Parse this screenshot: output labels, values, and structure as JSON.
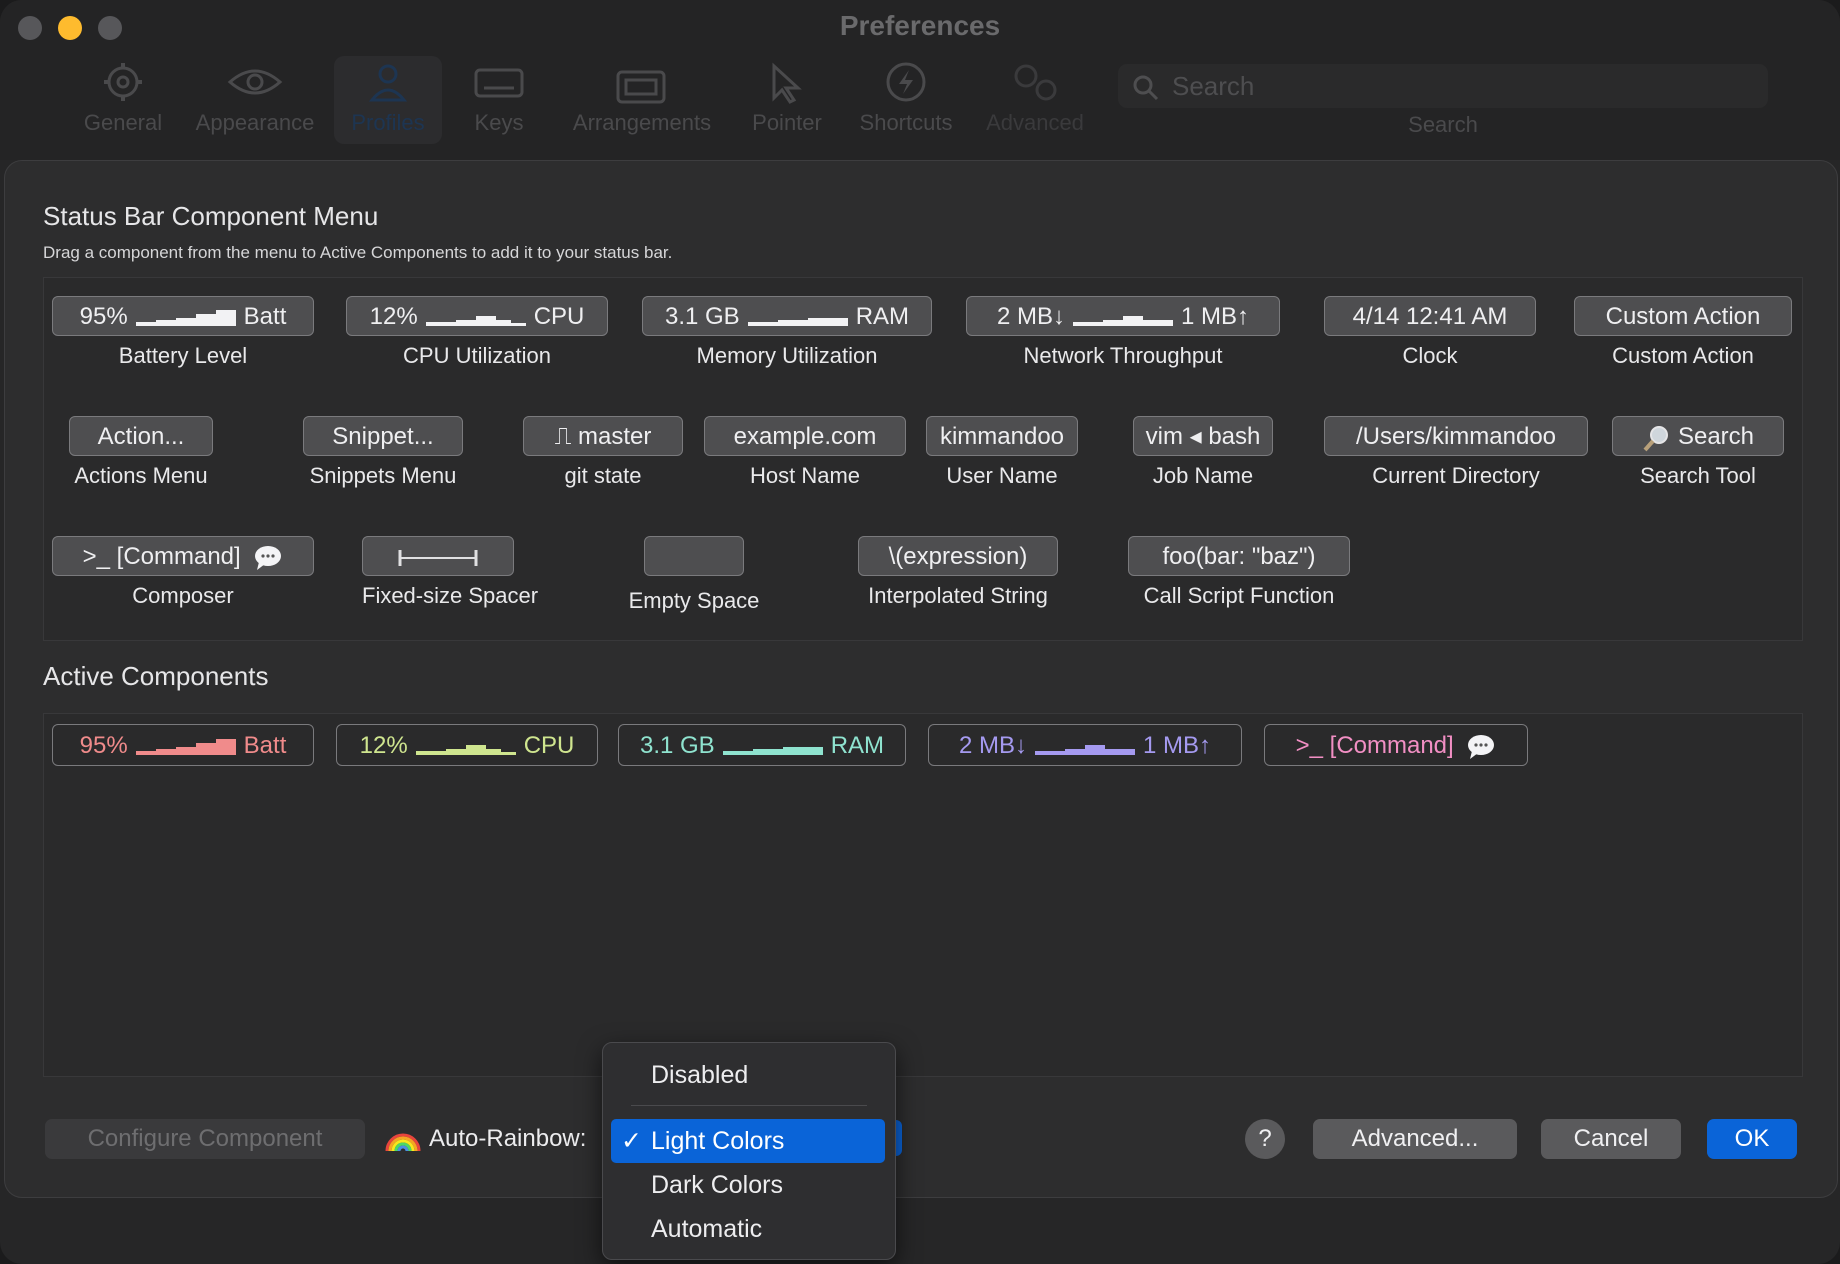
{
  "window": {
    "title": "Preferences"
  },
  "toolbar": {
    "items": [
      {
        "label": "General",
        "icon": "gear-icon"
      },
      {
        "label": "Appearance",
        "icon": "eye-icon"
      },
      {
        "label": "Profiles",
        "icon": "person-icon",
        "selected": true
      },
      {
        "label": "Keys",
        "icon": "keyboard-icon"
      },
      {
        "label": "Arrangements",
        "icon": "windows-icon"
      },
      {
        "label": "Pointer",
        "icon": "cursor-icon"
      },
      {
        "label": "Shortcuts",
        "icon": "bolt-icon"
      },
      {
        "label": "Advanced",
        "icon": "gears-icon"
      }
    ],
    "search": {
      "placeholder": "Search",
      "label": "Search"
    }
  },
  "menu": {
    "title": "Status Bar Component Menu",
    "subtitle": "Drag a component from the menu to Active Components to add it to your status bar.",
    "components": [
      {
        "left": "95%",
        "right": "Batt",
        "label": "Battery Level"
      },
      {
        "left": "12%",
        "right": "CPU",
        "label": "CPU Utilization"
      },
      {
        "left": "3.1 GB",
        "right": "RAM",
        "label": "Memory Utilization"
      },
      {
        "left": "2 MB↓",
        "right": "1 MB↑",
        "label": "Network Throughput"
      },
      {
        "text": "4/14 12:41 AM",
        "label": "Clock"
      },
      {
        "text": "Custom Action",
        "label": "Custom Action"
      },
      {
        "text": "Action...",
        "label": "Actions Menu"
      },
      {
        "text": "Snippet...",
        "label": "Snippets Menu"
      },
      {
        "text": "⎍ master",
        "label": "git state"
      },
      {
        "text": "example.com",
        "label": "Host Name"
      },
      {
        "text": "kimmandoo",
        "label": "User Name"
      },
      {
        "text": "vim ◂ bash",
        "label": "Job Name"
      },
      {
        "text": "/Users/kimmandoo",
        "label": "Current Directory"
      },
      {
        "text": "Search",
        "label": "Search Tool"
      },
      {
        "text": ">_ [Command]",
        "label": "Composer"
      },
      {
        "text": "",
        "label": "Fixed-size Spacer"
      },
      {
        "text": "",
        "label": "Empty Space"
      },
      {
        "text": "\\(expression)",
        "label": "Interpolated String"
      },
      {
        "text": "foo(bar: \"baz\")",
        "label": "Call Script Function"
      }
    ]
  },
  "active": {
    "title": "Active Components",
    "items": [
      {
        "left": "95%",
        "right": "Batt",
        "color": "#f08b8b"
      },
      {
        "left": "12%",
        "right": "CPU",
        "color": "#cfe58f"
      },
      {
        "left": "3.1 GB",
        "right": "RAM",
        "color": "#8fe3cf"
      },
      {
        "left": "2 MB↓",
        "right": "1 MB↑",
        "color": "#a59af0"
      },
      {
        "text": ">_ [Command]",
        "color": "#f28fc4"
      }
    ]
  },
  "bottom": {
    "configure": "Configure Component",
    "rainbow_label": "Auto-Rainbow:",
    "help": "?",
    "advanced": "Advanced...",
    "cancel": "Cancel",
    "ok": "OK"
  },
  "dropdown": {
    "options": [
      "Disabled",
      "Light Colors",
      "Dark Colors",
      "Automatic"
    ],
    "selected": "Light Colors",
    "check": "✓"
  }
}
